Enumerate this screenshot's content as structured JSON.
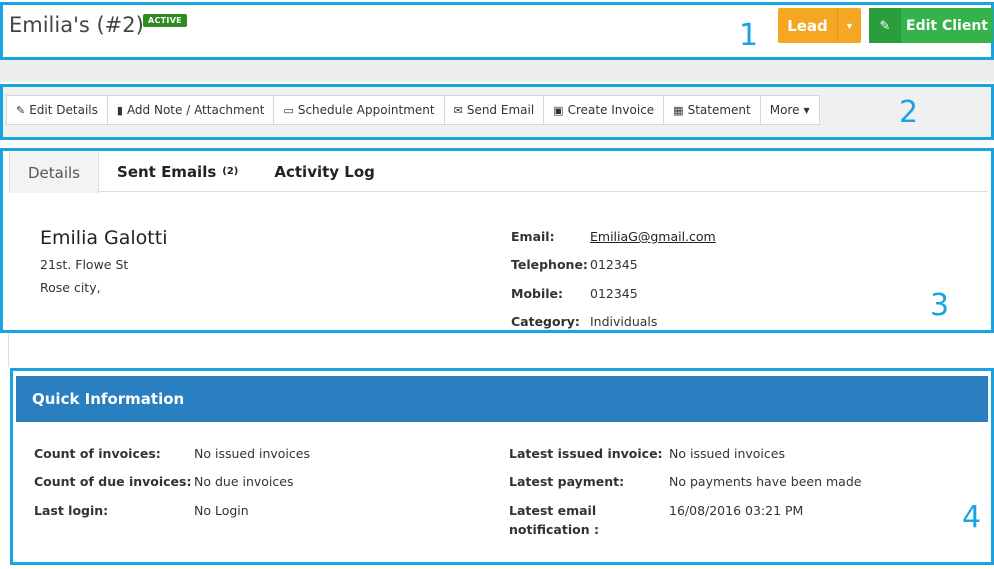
{
  "header": {
    "title": "Emilia's (#2)",
    "status_badge": "ACTIVE",
    "lead_label": "Lead",
    "edit_client_label": "Edit Client",
    "section_number": "1"
  },
  "toolbar": {
    "section_number": "2",
    "buttons": [
      {
        "label": "Edit Details",
        "icon": "pencil-icon"
      },
      {
        "label": "Add Note / Attachment",
        "icon": "book-icon"
      },
      {
        "label": "Schedule Appointment",
        "icon": "calendar-icon"
      },
      {
        "label": "Send Email",
        "icon": "envelope-icon"
      },
      {
        "label": "Create Invoice",
        "icon": "money-icon"
      },
      {
        "label": "Statement",
        "icon": "table-icon"
      },
      {
        "label": "More",
        "icon": "caret-down-icon"
      }
    ]
  },
  "details": {
    "section_number": "3",
    "tabs": [
      {
        "label": "Details"
      },
      {
        "label": "Sent Emails",
        "count": "(2)"
      },
      {
        "label": "Activity Log"
      }
    ],
    "name": "Emilia Galotti",
    "address_line1": "21st. Flowe St",
    "address_line2": "Rose city,",
    "fields": [
      {
        "label": "Email:",
        "value": "EmiliaG@gmail.com"
      },
      {
        "label": "Telephone:",
        "value": "012345"
      },
      {
        "label": "Mobile:",
        "value": "012345"
      },
      {
        "label": "Category:",
        "value": "Individuals"
      }
    ]
  },
  "quick_info": {
    "section_number": "4",
    "title": "Quick Information",
    "left": [
      {
        "label": "Count of invoices:",
        "value": "No issued invoices"
      },
      {
        "label": "Count of due invoices:",
        "value": "No due invoices"
      },
      {
        "label": "Last login:",
        "value": "No Login"
      }
    ],
    "right": [
      {
        "label": "Latest issued invoice:",
        "value": "No issued invoices"
      },
      {
        "label": "Latest payment:",
        "value": "No payments have been made"
      },
      {
        "label": "Latest email notification :",
        "value": "16/08/2016 03:21 PM"
      }
    ]
  },
  "colors": {
    "annotation_blue": "#19a3e0",
    "lead_orange": "#f5a623",
    "edit_green": "#35b34a",
    "active_badge_green": "#2e8b22",
    "quick_info_header_blue": "#2a7fc0"
  }
}
